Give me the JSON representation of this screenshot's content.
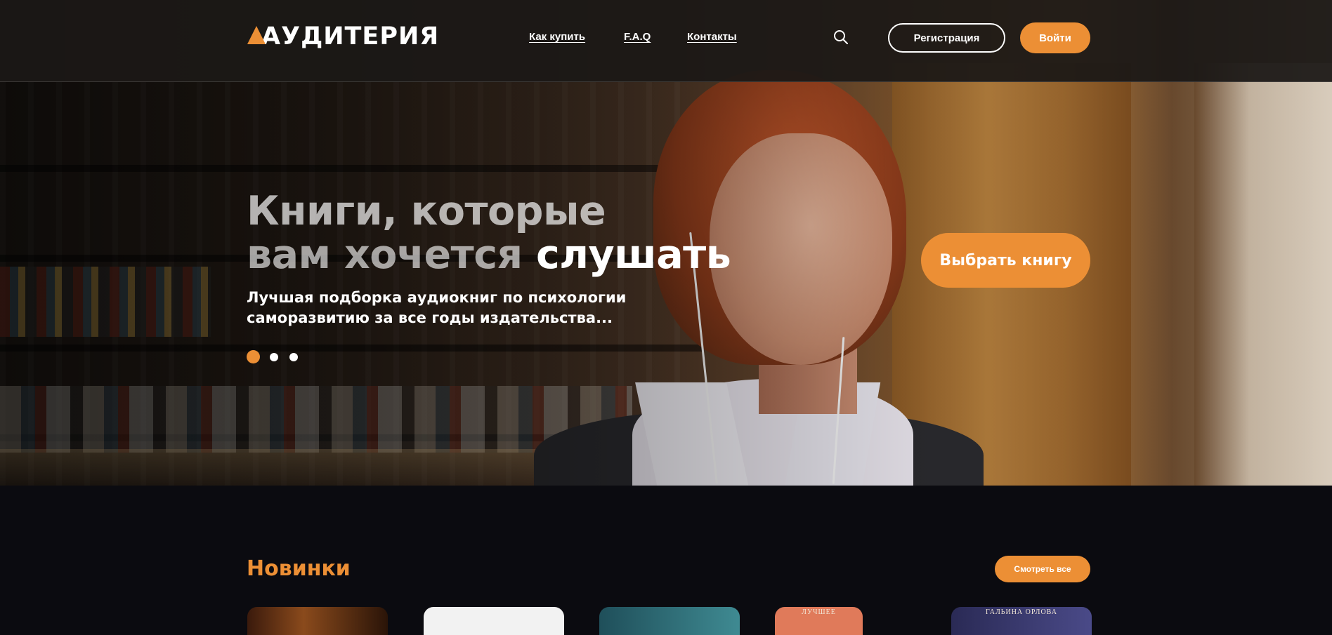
{
  "brand": {
    "name": "АУДИТЕРИЯ",
    "accent_color": "#ec8f35"
  },
  "header": {
    "nav": [
      {
        "label": "Как купить"
      },
      {
        "label": "F.A.Q"
      },
      {
        "label": "Контакты"
      }
    ],
    "search_icon": "search-icon",
    "register_label": "Регистрация",
    "login_label": "Войти"
  },
  "hero": {
    "title_line1": "Книги, которые",
    "title_line2_dim": "вам хочется ",
    "title_line2_bright": "слушать",
    "subtitle": "Лучшая подборка аудиокниг по психологии саморазвитию за все годы издательства...",
    "cta_label": "Выбрать книгу",
    "slides": 3,
    "active_slide": 1
  },
  "new_releases": {
    "title": "Новинки",
    "view_all_label": "Смотреть все",
    "covers": [
      {
        "color": "#5a2a14",
        "text": ""
      },
      {
        "color": "#f2f2f2",
        "text": ""
      },
      {
        "color": "#2f6f7a",
        "text": ""
      },
      {
        "color": "#e07a5a",
        "text": "ЛУЧШЕЕ"
      },
      {
        "color": "#3a3a66",
        "text": "ГАЛЬИНА ОРЛОВА"
      }
    ]
  }
}
